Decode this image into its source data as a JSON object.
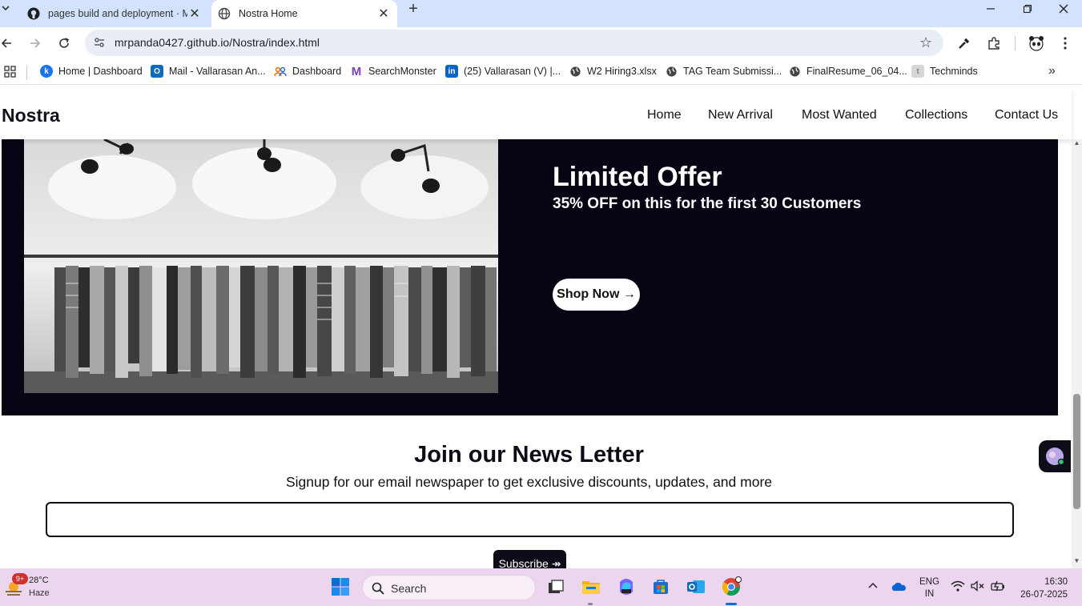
{
  "browser": {
    "tabs": [
      {
        "title": "pages build and deployment · M",
        "active": false
      },
      {
        "title": "Nostra Home",
        "active": true
      }
    ],
    "url": "mrpanda0427.github.io/Nostra/index.html",
    "bookmarks": [
      {
        "label": "Home | Dashboard",
        "icon": "k-icon",
        "color": "#1a73e8"
      },
      {
        "label": "Mail - Vallarasan An...",
        "icon": "outlook-icon",
        "color": "#0f6cbd"
      },
      {
        "label": "Dashboard",
        "icon": "people-icon",
        "color": "#e37400"
      },
      {
        "label": "SearchMonster",
        "icon": "m-icon",
        "color": "#7b3fbf"
      },
      {
        "label": "(25) Vallarasan (V) |...",
        "icon": "linkedin-icon",
        "color": "#0a66c2"
      },
      {
        "label": "W2 Hiring3.xlsx",
        "icon": "globe-icon",
        "color": "#444444"
      },
      {
        "label": "TAG Team Submissi...",
        "icon": "globe-icon",
        "color": "#444444"
      },
      {
        "label": "FinalResume_06_04...",
        "icon": "globe-icon",
        "color": "#444444"
      },
      {
        "label": "Techminds",
        "icon": "t-icon",
        "color": "#bbbbbb"
      }
    ]
  },
  "site": {
    "brand": "Nostra",
    "nav": [
      "Home",
      "New Arrival",
      "Most Wanted",
      "Collections",
      "Contact Us"
    ],
    "offer": {
      "title": "Limited Offer",
      "discount": "35% OFF",
      "subtitle_rest": "on this for the first 30 Customers",
      "button": "Shop Now →"
    },
    "newsletter": {
      "title": "Join our News Letter",
      "subtitle": "Signup for our email newspaper to get exclusive discounts, updates, and more",
      "input_value": "",
      "button": "Subscribe ↠"
    }
  },
  "taskbar": {
    "weather_badge": "9+",
    "temperature": "28°C",
    "condition": "Haze",
    "search_placeholder": "Search",
    "lang_top": "ENG",
    "lang_bottom": "IN",
    "time": "16:30",
    "date": "26-07-2025"
  }
}
